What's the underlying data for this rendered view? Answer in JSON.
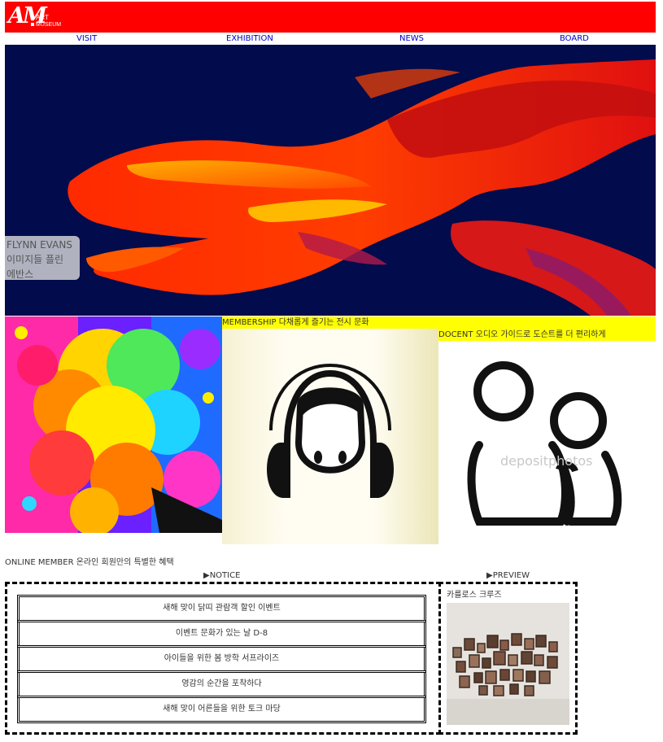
{
  "header": {
    "logo_mark": "AM",
    "logo_line1": "ART",
    "logo_line2": "MUSEUM",
    "brand_color": "#ff0000"
  },
  "nav": {
    "items": [
      {
        "label": "VISIT"
      },
      {
        "label": "EXHIBITION"
      },
      {
        "label": "NEWS"
      },
      {
        "label": "BOARD"
      }
    ]
  },
  "hero": {
    "caption_line1": "FLYNN EVANS",
    "caption_line2": "이미지들 플린",
    "caption_line3": "에반스"
  },
  "features": {
    "membership_label": "MEMBERSHIP 다채롭게 즐기는 전시 문화",
    "docent_label": "DOCENT 오디오 가이드로 도슨트를 더 편리하게",
    "watermark": "depositphotos",
    "highlight_color": "#ffff00"
  },
  "online": {
    "label": "ONLINE MEMBER 온라인 회원만의 특별한 혜택"
  },
  "notice": {
    "title": "▶NOTICE",
    "items": [
      "새해 맞이 닭띠 관람객 할인 이벤트",
      "이벤트 문화가 있는 날 D-8",
      "아이들을 위한 봄 방학 서프라이즈",
      "영감의 순간을 포착하다",
      "새해 맞이 어른들을 위한 토크 마당"
    ]
  },
  "preview": {
    "title": "▶PREVIEW",
    "caption": "카를로스 크루즈"
  }
}
